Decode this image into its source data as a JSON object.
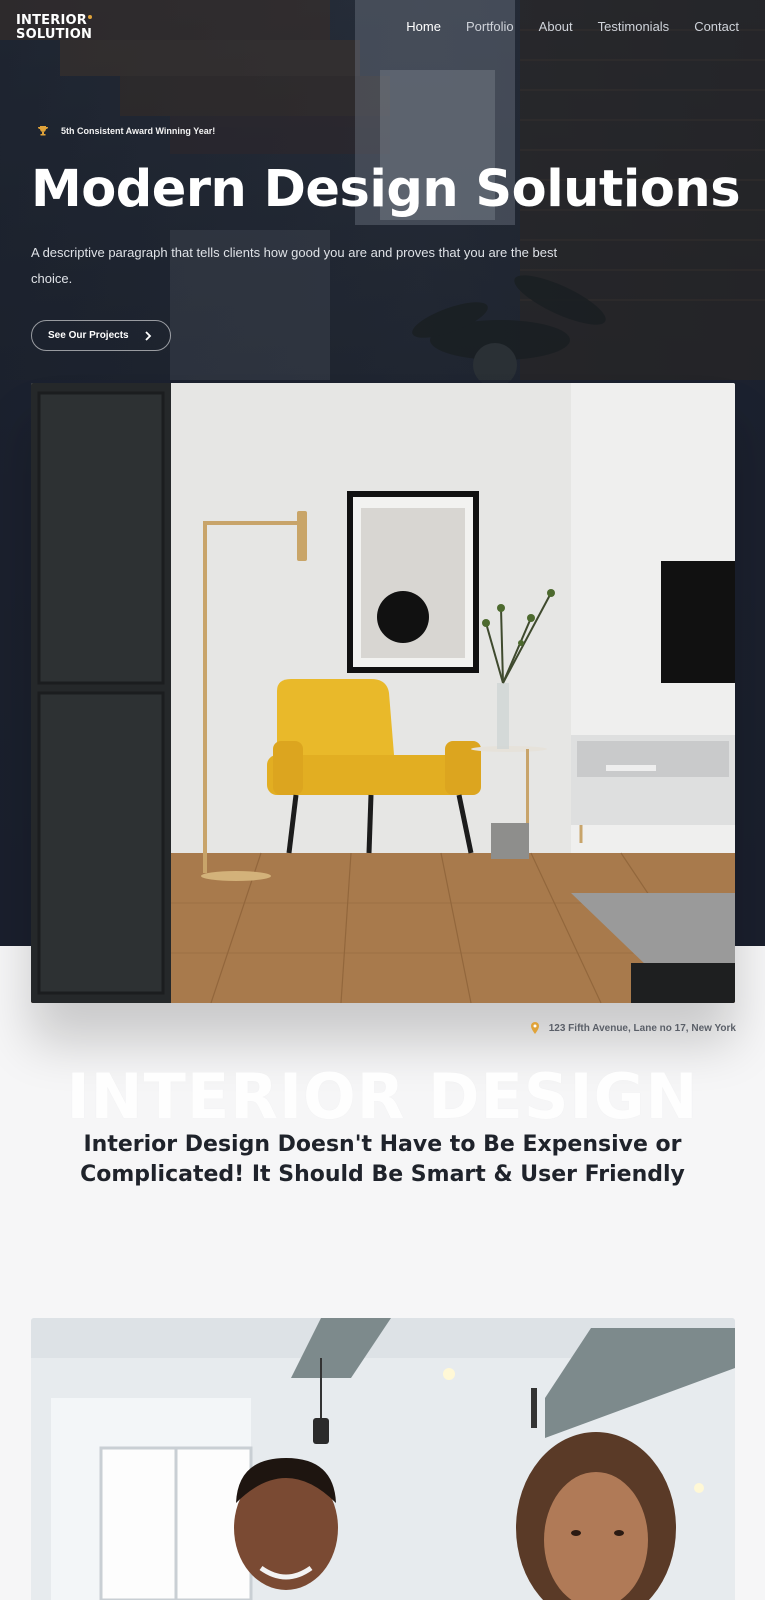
{
  "brand": {
    "line1": "INTERIOR",
    "line2": "SOLUTION",
    "accent": "#e0a33a"
  },
  "nav": [
    {
      "label": "Home",
      "active": true
    },
    {
      "label": "Portfolio"
    },
    {
      "label": "About"
    },
    {
      "label": "Testimonials"
    },
    {
      "label": "Contact"
    }
  ],
  "hero": {
    "award": "5th Consistent Award Winning Year!",
    "award_icon": "trophy-icon",
    "title": "Modern Design Solutions",
    "description": "A descriptive paragraph that tells clients how good you are and proves that you are the best choice.",
    "cta": "See Our Projects",
    "cta_icon": "chevron-right-icon"
  },
  "address": {
    "icon": "map-pin-icon",
    "text": "123 Fifth Avenue, Lane no 17, New York"
  },
  "intro": {
    "watermark": "INTERIOR DESIGN",
    "title_line1": "Interior Design Doesn't Have to Be Expensive or",
    "title_line2": "Complicated! It Should Be Smart & User Friendly"
  },
  "colors": {
    "hero_bg": "#232a35",
    "accent": "#e0a33a",
    "chair": "#e9b92a",
    "page_bg": "#f6f6f7"
  }
}
